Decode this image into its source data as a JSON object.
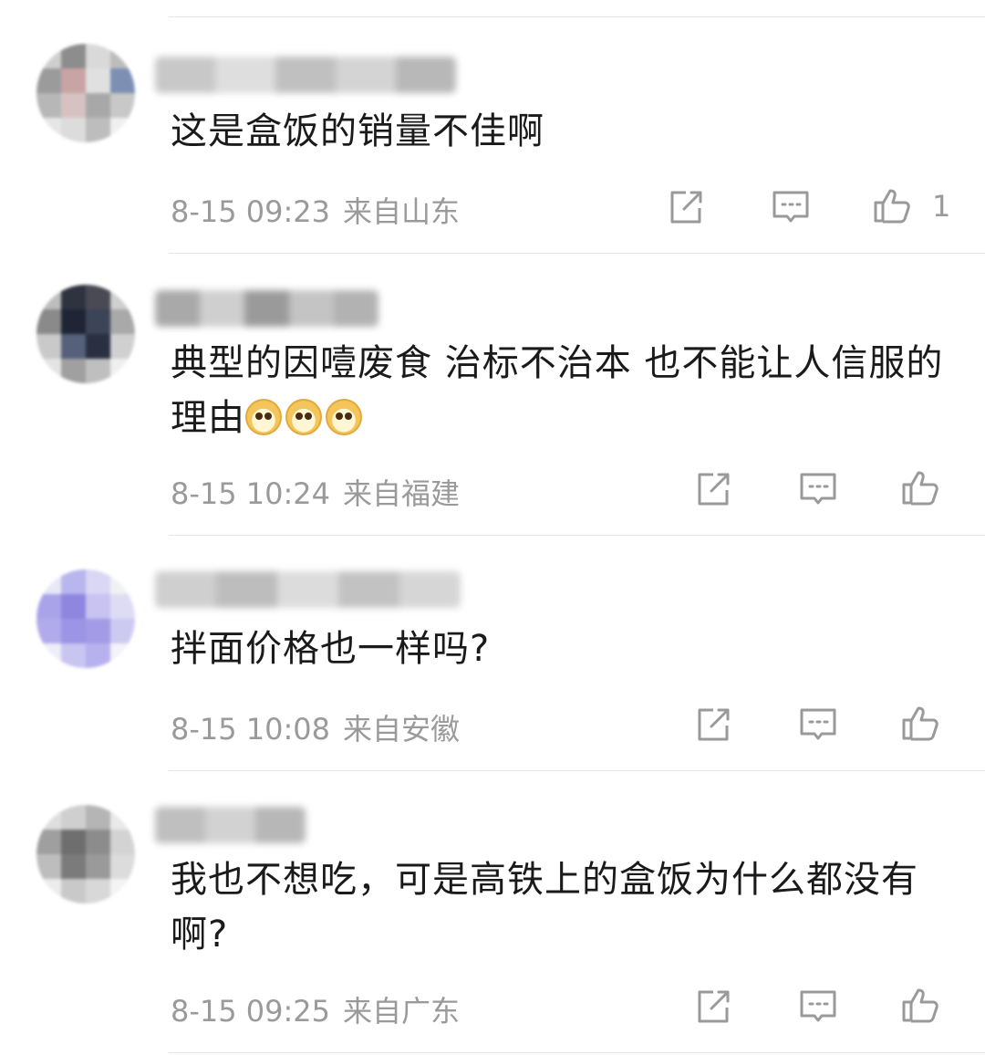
{
  "comments": [
    {
      "text": "这是盒饭的销量不佳啊",
      "time": "8-15 09:23",
      "location": "来自山东",
      "like_count": "1",
      "avatar_colors": [
        "#cfcfcf",
        "#8d8d8d",
        "#d9d9d9",
        "#bcbcbc",
        "#9b9b9b",
        "#c9a4a4",
        "#e0e0e0",
        "#7d8fb3",
        "#b7b7b7",
        "#d7c2c2",
        "#a8a8a8",
        "#c8c8c8",
        "#e6e6e6",
        "#dcdcdc",
        "#bdbdbd",
        "#f0f0f0"
      ],
      "name_colors": [
        "#c8c8c8",
        "#dedede",
        "#c0c0c0",
        "#d4d4d4",
        "#b8b8b8"
      ]
    },
    {
      "text": "典型的因噎废食  治标不治本 也不能让人信服的理由",
      "emoji_count": 3,
      "time": "8-15 10:24",
      "location": "来自福建",
      "like_count": "",
      "avatar_colors": [
        "#bdbdbd",
        "#2f3340",
        "#4a4a55",
        "#cfcfcf",
        "#8a8a8a",
        "#1f2535",
        "#3c4458",
        "#a9a9a9",
        "#c9c9c9",
        "#55607a",
        "#2a3042",
        "#d0d0d0",
        "#e4e4e4",
        "#a0a0a0",
        "#bfbfbf",
        "#efefef"
      ],
      "name_colors": [
        "#a9a9a9",
        "#cfcfcf",
        "#9a9a9a",
        "#c4c4c4",
        "#b2b2b2"
      ]
    },
    {
      "text": "拌面价格也一样吗?",
      "time": "8-15 10:08",
      "location": "来自安徽",
      "like_count": "",
      "avatar_colors": [
        "#e8e8f7",
        "#b9b5ee",
        "#d9d7f4",
        "#f1f1f1",
        "#a9a3ea",
        "#8f86e0",
        "#c8c3f0",
        "#dedcf4",
        "#b1abeb",
        "#9c94e4",
        "#a39be6",
        "#cdcaf2",
        "#eeeef8",
        "#c9c5f1",
        "#b7b1ee",
        "#f3f3f8"
      ],
      "name_colors": [
        "#cfcfcf",
        "#bdbdbd",
        "#dcdcdc",
        "#c2c2c2",
        "#d6d6d6"
      ]
    },
    {
      "text": "我也不想吃，可是高铁上的盒饭为什么都没有啊?",
      "time": "8-15 09:25",
      "location": "来自广东",
      "like_count": "",
      "avatar_colors": [
        "#dedede",
        "#cfcfcf",
        "#b5b5b5",
        "#e9e9e9",
        "#9f9f9f",
        "#6e6e6e",
        "#8c8c8c",
        "#d3d3d3",
        "#bdbdbd",
        "#7b7b7b",
        "#9a9a9a",
        "#dcdcdc",
        "#ececec",
        "#c9c9c9",
        "#d8d8d8",
        "#f3f3f3"
      ],
      "name_colors": [
        "#bfbfbf",
        "#d2d2d2",
        "#b7b7b7"
      ]
    }
  ],
  "icons": {
    "share": "share-icon",
    "reply": "comment-icon",
    "like": "thumbs-up-icon"
  },
  "colors": {
    "text": "#1a1a1a",
    "meta": "#9a9a9a",
    "icon": "#9a9a9a",
    "divider": "#e6e6e6"
  }
}
